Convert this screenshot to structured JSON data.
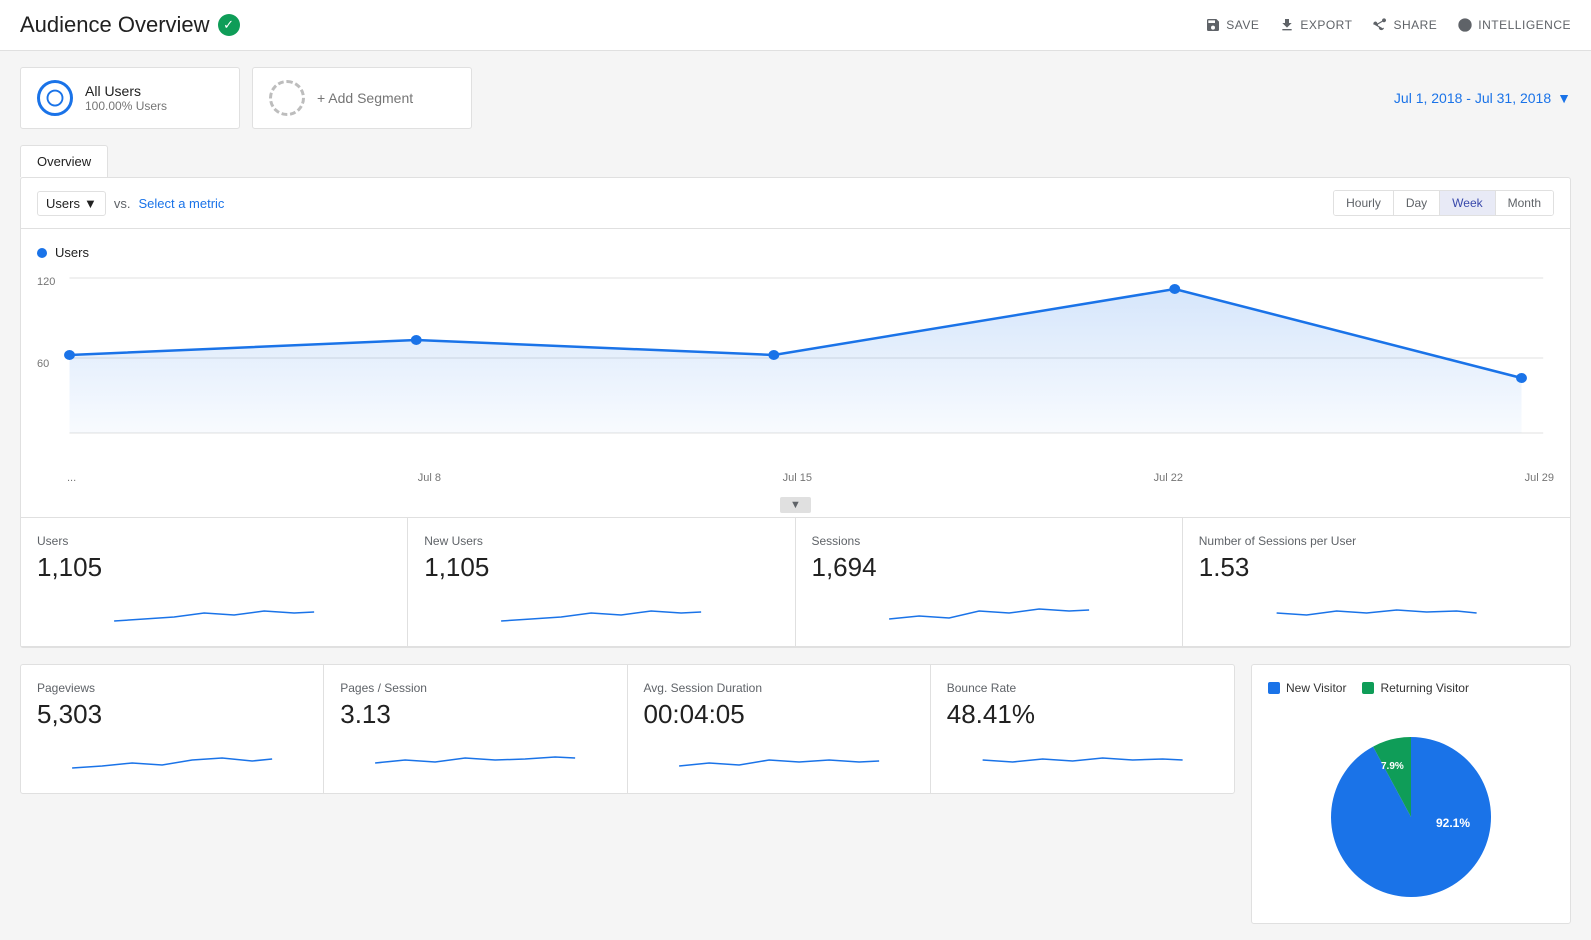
{
  "header": {
    "title": "Audience Overview",
    "save_label": "SAVE",
    "export_label": "EXPORT",
    "share_label": "SHARE",
    "intelligence_label": "INTELLIGENCE"
  },
  "segments": {
    "all_users": {
      "name": "All Users",
      "percentage": "100.00% Users"
    },
    "add_segment": "+ Add Segment"
  },
  "date_range": "Jul 1, 2018 - Jul 31, 2018",
  "overview_tab": "Overview",
  "chart": {
    "metric_label": "Users",
    "vs_label": "vs.",
    "select_metric": "Select a metric",
    "y_max": "120",
    "y_mid": "60",
    "x_labels": [
      "...",
      "Jul 8",
      "Jul 15",
      "Jul 22",
      "Jul 29"
    ],
    "time_buttons": [
      {
        "label": "Hourly",
        "active": false
      },
      {
        "label": "Day",
        "active": false
      },
      {
        "label": "Week",
        "active": true
      },
      {
        "label": "Month",
        "active": false
      }
    ]
  },
  "metrics_top": [
    {
      "label": "Users",
      "value": "1,105"
    },
    {
      "label": "New Users",
      "value": "1,105"
    },
    {
      "label": "Sessions",
      "value": "1,694"
    },
    {
      "label": "Number of Sessions per User",
      "value": "1.53"
    }
  ],
  "metrics_bottom": [
    {
      "label": "Pageviews",
      "value": "5,303"
    },
    {
      "label": "Pages / Session",
      "value": "3.13"
    },
    {
      "label": "Avg. Session Duration",
      "value": "00:04:05"
    },
    {
      "label": "Bounce Rate",
      "value": "48.41%"
    }
  ],
  "pie": {
    "new_visitor_label": "New Visitor",
    "returning_visitor_label": "Returning Visitor",
    "new_visitor_pct": "92.1%",
    "returning_visitor_pct": "7.9%",
    "new_visitor_color": "#1a73e8",
    "returning_visitor_color": "#0f9d58"
  }
}
